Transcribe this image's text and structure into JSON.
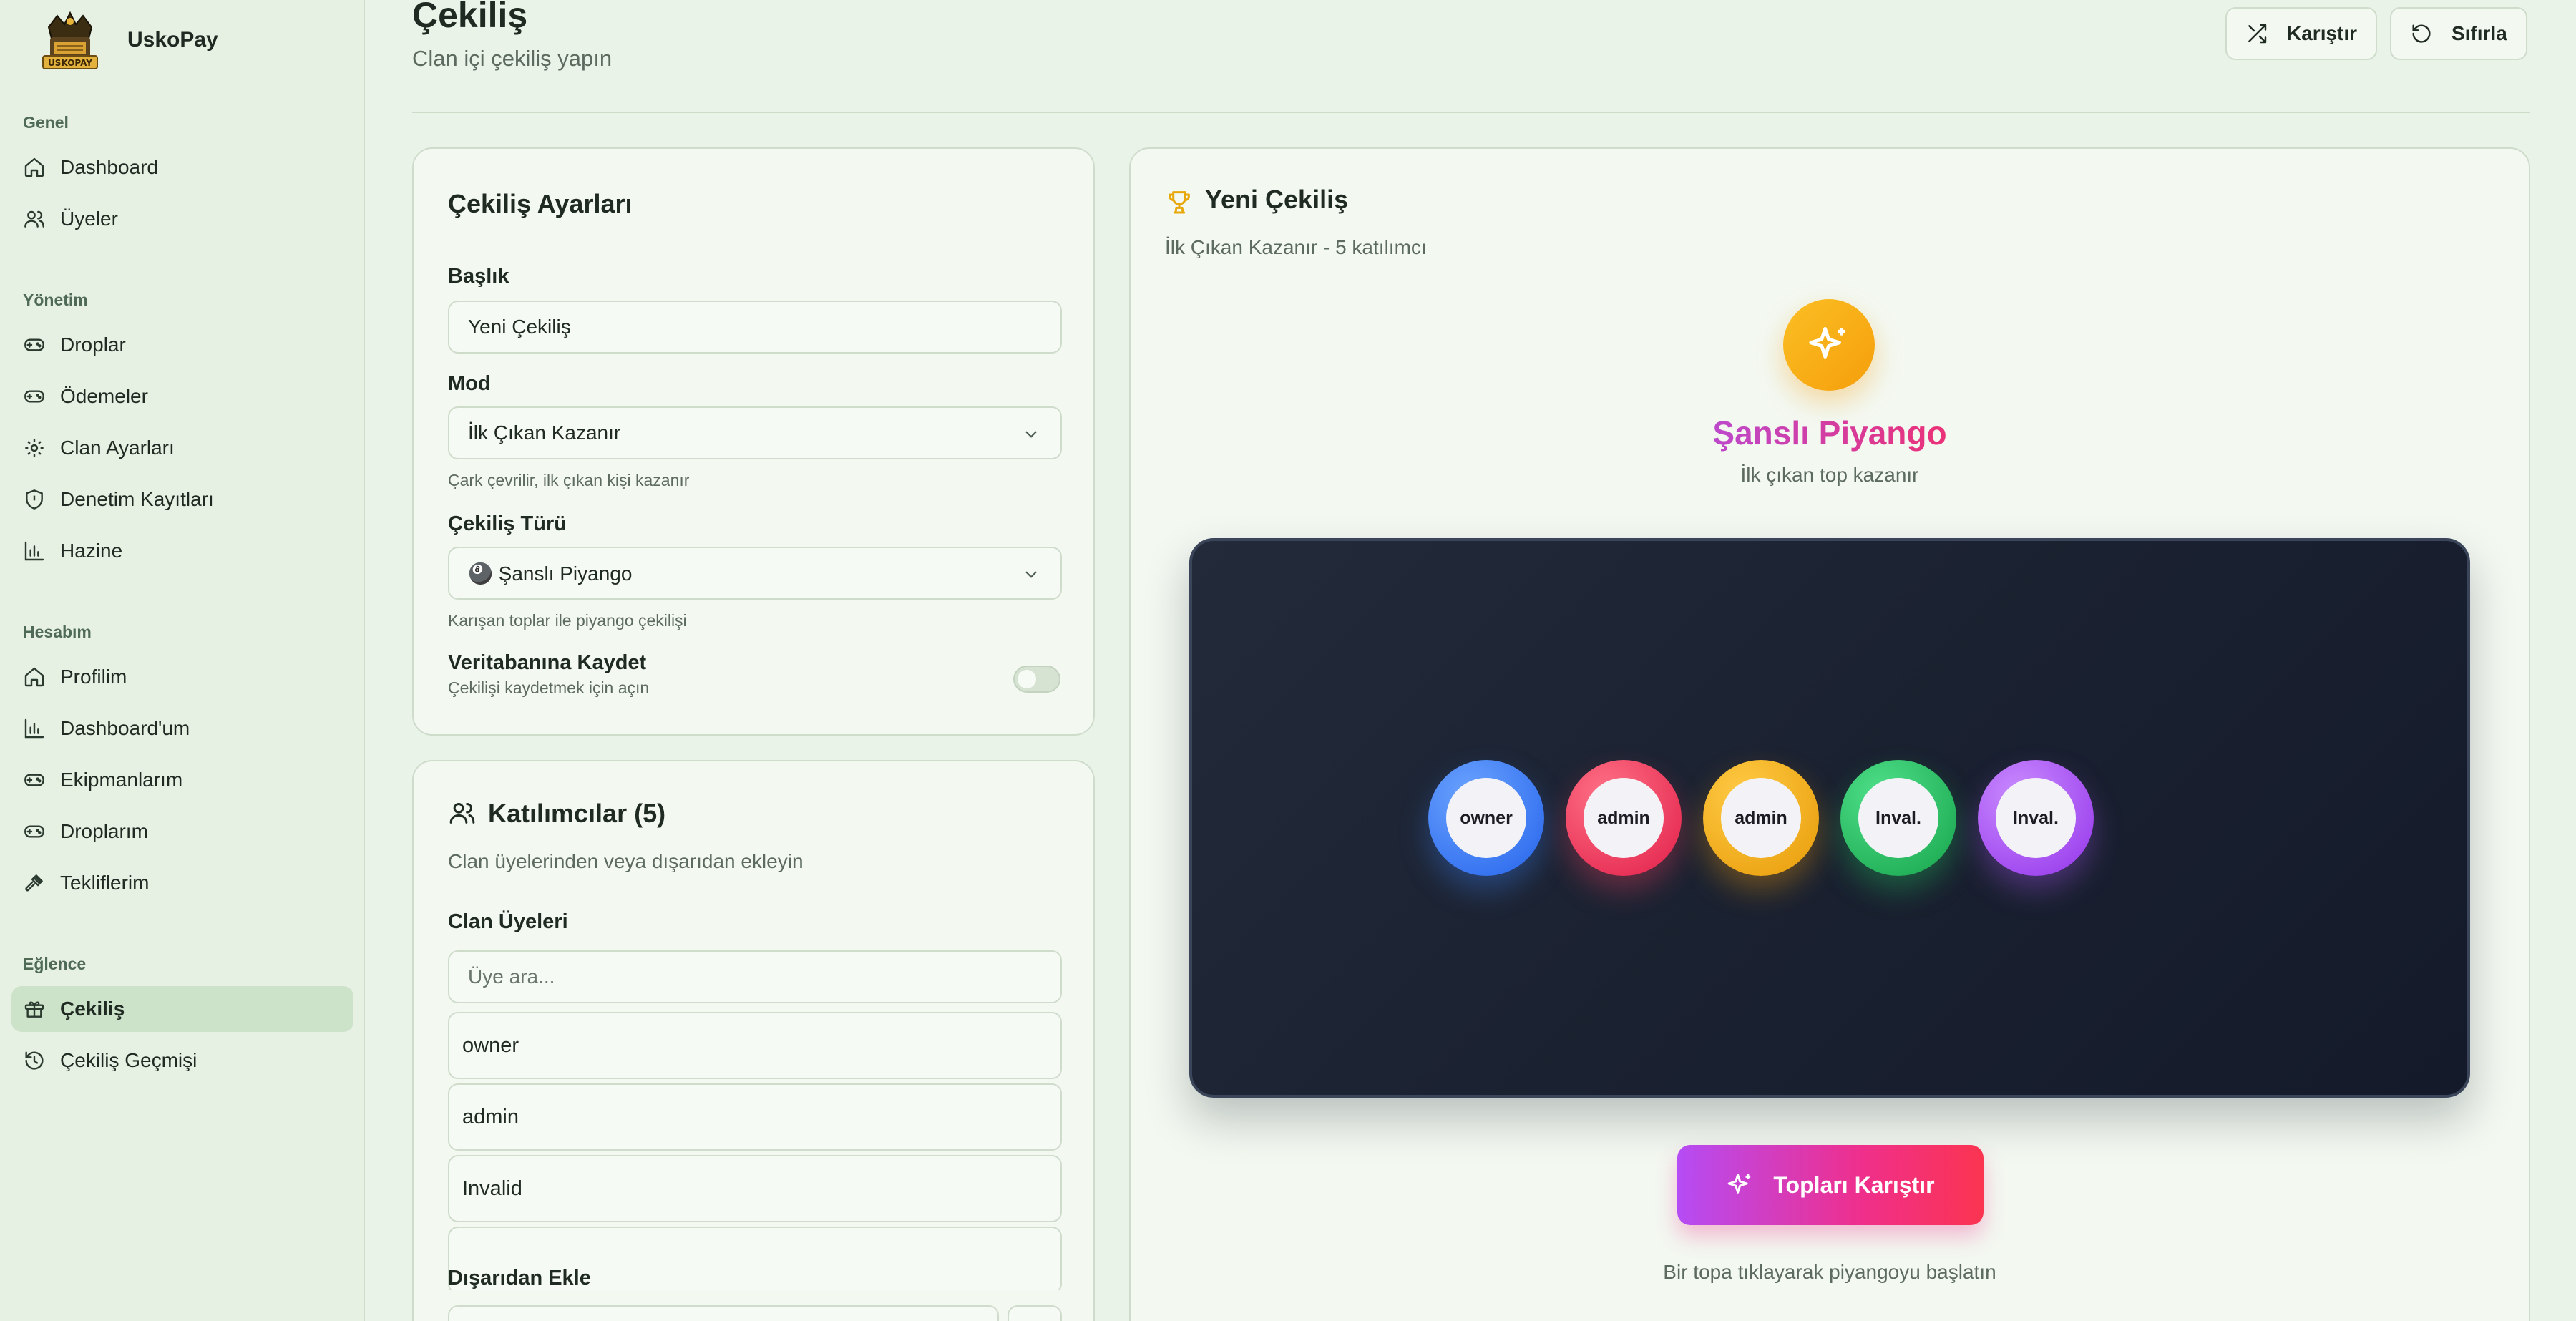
{
  "brand": {
    "name": "UskoPay",
    "logo_text": "USKOPAY"
  },
  "sidebar": {
    "sections": [
      {
        "title": "Genel",
        "items": [
          {
            "label": "Dashboard",
            "icon": "home-icon"
          },
          {
            "label": "Üyeler",
            "icon": "users-icon"
          }
        ]
      },
      {
        "title": "Yönetim",
        "items": [
          {
            "label": "Droplar",
            "icon": "gamepad-icon"
          },
          {
            "label": "Ödemeler",
            "icon": "gamepad-icon"
          },
          {
            "label": "Clan Ayarları",
            "icon": "gear-icon"
          },
          {
            "label": "Denetim Kayıtları",
            "icon": "shield-icon"
          },
          {
            "label": "Hazine",
            "icon": "bar-chart-icon"
          }
        ]
      },
      {
        "title": "Hesabım",
        "items": [
          {
            "label": "Profilim",
            "icon": "home-icon"
          },
          {
            "label": "Dashboard'um",
            "icon": "bar-chart-icon"
          },
          {
            "label": "Ekipmanlarım",
            "icon": "gamepad-icon"
          },
          {
            "label": "Droplarım",
            "icon": "gamepad-icon"
          },
          {
            "label": "Tekliflerim",
            "icon": "gavel-icon"
          }
        ]
      },
      {
        "title": "Eğlence",
        "items": [
          {
            "label": "Çekiliş",
            "icon": "gift-icon",
            "active": true
          },
          {
            "label": "Çekiliş Geçmişi",
            "icon": "history-icon"
          }
        ]
      }
    ]
  },
  "header": {
    "title": "Çekiliş",
    "subtitle": "Clan içi çekiliş yapın",
    "shuffle_label": "Karıştır",
    "reset_label": "Sıfırla"
  },
  "settings": {
    "title": "Çekiliş Ayarları",
    "title_label": "Başlık",
    "title_value": "Yeni Çekiliş",
    "mode_label": "Mod",
    "mode_value": "İlk Çıkan Kazanır",
    "mode_hint": "Çark çevrilir, ilk çıkan kişi kazanır",
    "type_label": "Çekiliş Türü",
    "type_value": "🎱 Şanslı Piyango",
    "type_hint": "Karışan toplar ile piyango çekilişi",
    "save_label": "Veritabanına Kaydet",
    "save_hint": "Çekilişi kaydetmek için açın",
    "save_enabled": false
  },
  "participants": {
    "title": "Katılımcılar (5)",
    "subtitle": "Clan üyelerinden veya dışarıdan ekleyin",
    "members_label": "Clan Üyeleri",
    "search_placeholder": "Üye ara...",
    "members": [
      "owner",
      "admin",
      "Invalid"
    ],
    "external_label": "Dışarıdan Ekle"
  },
  "draw": {
    "title": "Yeni Çekiliş",
    "subtitle": "İlk Çıkan Kazanır - 5 katılımcı",
    "game_title": "Şanslı Piyango",
    "game_subtitle": "İlk çıkan top kazanır",
    "balls": [
      {
        "label": "owner",
        "color": "#3b82f6"
      },
      {
        "label": "admin",
        "color": "#f43f5e"
      },
      {
        "label": "admin",
        "color": "#f59e0b"
      },
      {
        "label": "Inval.",
        "color": "#22c55e"
      },
      {
        "label": "Inval.",
        "color": "#a855f7"
      }
    ],
    "mix_label": "Topları Karıştır",
    "footer_hint": "Bir topa tıklayarak piyangoyu başlatın"
  },
  "colors": {
    "accent_gold": "#f8b50c",
    "gradient_start": "#b54cf5",
    "gradient_end": "#fb3450"
  }
}
